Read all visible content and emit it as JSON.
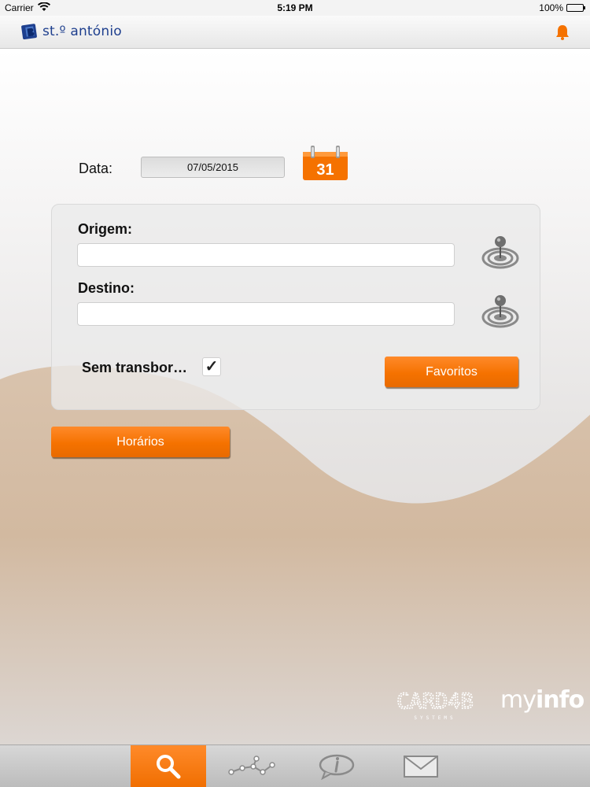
{
  "status_bar": {
    "carrier": "Carrier",
    "time": "5:19 PM",
    "battery": "100%",
    "icons": [
      "wifi-icon",
      "battery-icon"
    ]
  },
  "header": {
    "brand": "st.º antónio",
    "icons": [
      "logo-icon",
      "bell-icon"
    ]
  },
  "form": {
    "date_label": "Data:",
    "date_value": "07/05/2015",
    "calendar_day": "31",
    "origin_label": "Origem:",
    "origin_value": "",
    "destination_label": "Destino:",
    "destination_value": "",
    "no_transfer_label": "Sem transbor…",
    "no_transfer_checked": true,
    "check_mark": "✓",
    "favorites_button": "Favoritos",
    "schedules_button": "Horários"
  },
  "footer_logos": {
    "card4b": "CARD4B",
    "card4b_sub": "SYSTEMS",
    "myinfo_light": "my",
    "myinfo_bold": "info"
  },
  "tabbar": {
    "tabs": [
      {
        "icon": "search-icon",
        "active": true
      },
      {
        "icon": "network-icon",
        "active": false
      },
      {
        "icon": "info-icon",
        "active": false
      },
      {
        "icon": "mail-icon",
        "active": false
      }
    ]
  },
  "colors": {
    "accent": "#f57200",
    "brand_blue": "#1e3f8e",
    "wave": "#c7a98c"
  }
}
